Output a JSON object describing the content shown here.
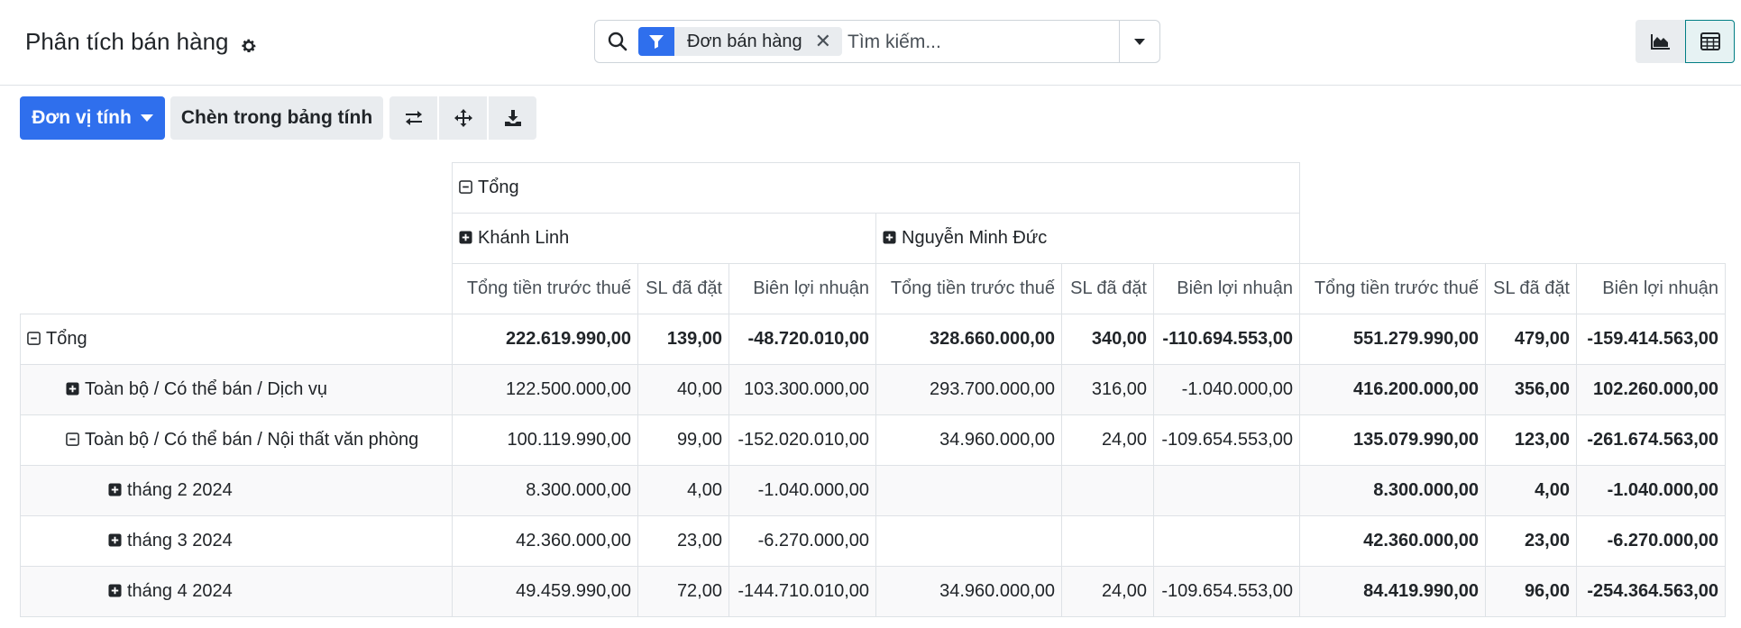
{
  "app": {
    "title": "Phân tích bán hàng"
  },
  "search": {
    "facet_label": "Đơn bán hàng",
    "placeholder": "Tìm kiếm..."
  },
  "toolbar": {
    "measures_label": "Đơn vị tính",
    "insert_label": "Chèn trong bảng tính"
  },
  "colors": {
    "primary": "#2f6fed",
    "active_view_border": "#017e84"
  },
  "pivot": {
    "col_root": "Tổng",
    "col_groups": [
      "Khánh Linh",
      "Nguyễn Minh Đức"
    ],
    "measures": [
      "Tổng tiền trước thuế",
      "SL đã đặt",
      "Biên lợi nhuận"
    ],
    "rows": [
      {
        "label": "Tổng",
        "icon": "minus-square-icon",
        "values": [
          "222.619.990,00",
          "139,00",
          "-48.720.010,00",
          "328.660.000,00",
          "340,00",
          "-110.694.553,00",
          "551.279.990,00",
          "479,00",
          "-159.414.563,00"
        ]
      },
      {
        "label": "Toàn bộ / Có thể bán / Dịch vụ",
        "icon": "plus-square-icon",
        "values": [
          "122.500.000,00",
          "40,00",
          "103.300.000,00",
          "293.700.000,00",
          "316,00",
          "-1.040.000,00",
          "416.200.000,00",
          "356,00",
          "102.260.000,00"
        ]
      },
      {
        "label": "Toàn bộ / Có thể bán / Nội thất văn phòng",
        "icon": "minus-square-icon",
        "values": [
          "100.119.990,00",
          "99,00",
          "-152.020.010,00",
          "34.960.000,00",
          "24,00",
          "-109.654.553,00",
          "135.079.990,00",
          "123,00",
          "-261.674.563,00"
        ]
      },
      {
        "label": "tháng 2 2024",
        "icon": "plus-square-icon",
        "values": [
          "8.300.000,00",
          "4,00",
          "-1.040.000,00",
          "",
          "",
          "",
          "8.300.000,00",
          "4,00",
          "-1.040.000,00"
        ]
      },
      {
        "label": "tháng 3 2024",
        "icon": "plus-square-icon",
        "values": [
          "42.360.000,00",
          "23,00",
          "-6.270.000,00",
          "",
          "",
          "",
          "42.360.000,00",
          "23,00",
          "-6.270.000,00"
        ]
      },
      {
        "label": "tháng 4 2024",
        "icon": "plus-square-icon",
        "values": [
          "49.459.990,00",
          "72,00",
          "-144.710.010,00",
          "34.960.000,00",
          "24,00",
          "-109.654.553,00",
          "84.419.990,00",
          "96,00",
          "-254.364.563,00"
        ]
      }
    ]
  }
}
